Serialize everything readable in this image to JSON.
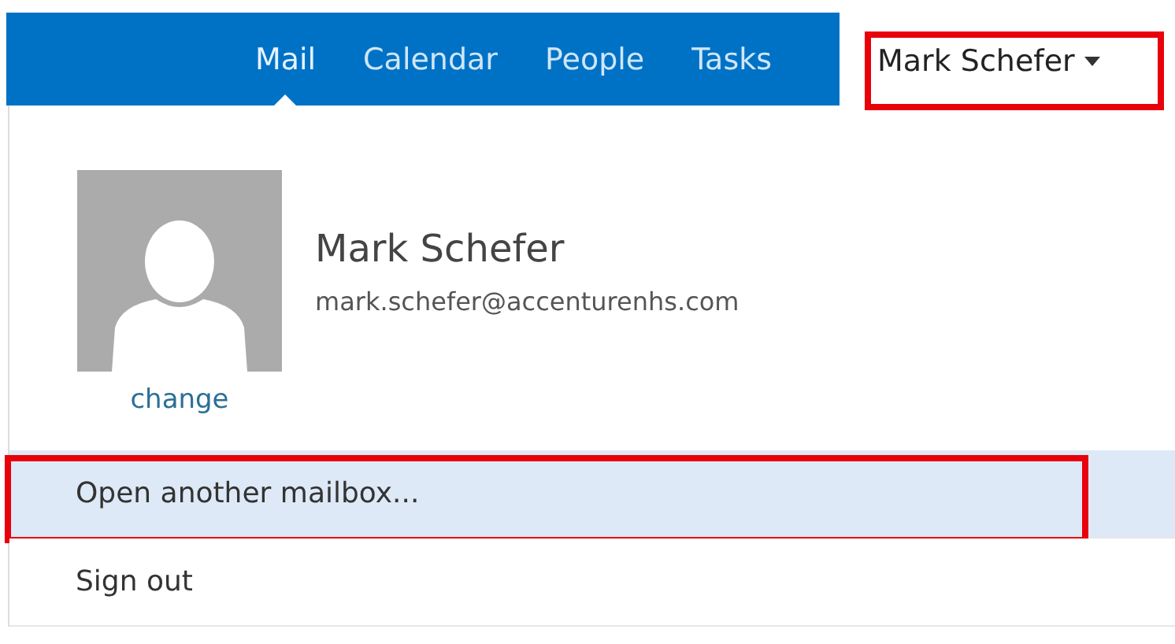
{
  "nav": {
    "tabs": [
      {
        "label": "Mail",
        "selected": true
      },
      {
        "label": "Calendar",
        "selected": false
      },
      {
        "label": "People",
        "selected": false
      },
      {
        "label": "Tasks",
        "selected": false
      }
    ],
    "account": {
      "label": "Mark Schefer",
      "annotated": true
    }
  },
  "profile": {
    "name": "Mark Schefer",
    "email": "mark.schefer@accenturenhs.com",
    "change_link": "change"
  },
  "menu": [
    {
      "label": "Open another mailbox...",
      "selected": true,
      "annotated": true
    },
    {
      "label": "Sign out",
      "selected": false,
      "annotated": false
    }
  ]
}
